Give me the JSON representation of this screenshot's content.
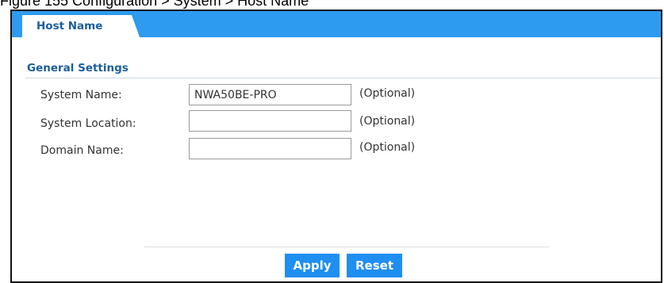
{
  "caption": "Figure 155   Configuration > System > Host Name",
  "tabs": [
    {
      "label": "Host Name"
    }
  ],
  "section": {
    "title": "General Settings"
  },
  "fields": [
    {
      "label": "System Name:",
      "value": "NWA50BE-PRO",
      "hint": "(Optional)"
    },
    {
      "label": "System Location:",
      "value": "",
      "hint": "(Optional)"
    },
    {
      "label": "Domain Name:",
      "value": "",
      "hint": "(Optional)"
    }
  ],
  "buttons": {
    "apply": "Apply",
    "reset": "Reset"
  },
  "colors": {
    "tabbar": "#2d9bf0",
    "button": "#1f8ef1",
    "title_text": "#1b5e9b"
  }
}
